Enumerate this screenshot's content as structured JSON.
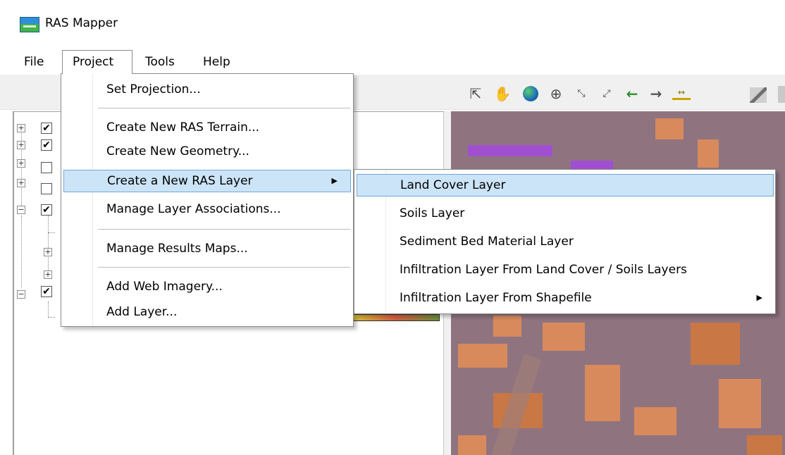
{
  "window": {
    "title": "RAS Mapper",
    "app_icon": "ras-mapper-icon"
  },
  "menubar": {
    "file": "File",
    "project": "Project",
    "tools": "Tools",
    "help": "Help"
  },
  "toolbar": {
    "icons": [
      "pointer-icon",
      "pan-hand-icon",
      "globe-icon",
      "zoom-in-icon",
      "zoom-to-extent-icon",
      "full-extent-icon",
      "arrow-left-icon",
      "arrow-right-icon",
      "measure-icon",
      "profile-icon"
    ]
  },
  "project_menu": {
    "items": [
      {
        "label": "Set Projection..."
      },
      {
        "label": "Create New RAS Terrain..."
      },
      {
        "label": "Create New Geometry..."
      },
      {
        "label": "Create a New RAS Layer",
        "submenu": true,
        "highlighted": true
      },
      {
        "label": "Manage Layer Associations..."
      },
      {
        "label": "Manage Results Maps..."
      },
      {
        "label": "Add Web Imagery..."
      },
      {
        "label": "Add Layer..."
      }
    ],
    "submenu_arrow": "▶"
  },
  "ras_layer_submenu": {
    "items": [
      {
        "label": "Land Cover Layer",
        "highlighted": true
      },
      {
        "label": "Soils Layer"
      },
      {
        "label": "Sediment Bed Material Layer"
      },
      {
        "label": "Infiltration Layer From Land Cover / Soils Layers"
      },
      {
        "label": "Infiltration Layer From Shapefile",
        "submenu": true
      }
    ],
    "submenu_arrow": "▶"
  },
  "layer_tree": {
    "checked_mark": "✔",
    "expand_mark": "+",
    "collapse_mark": "−"
  },
  "colors": {
    "menu_highlight": "#cce4f7",
    "menu_highlight_border": "#6fa8dc",
    "map_background": "#8f7480",
    "land_cover_orange": "#d88a5c"
  }
}
